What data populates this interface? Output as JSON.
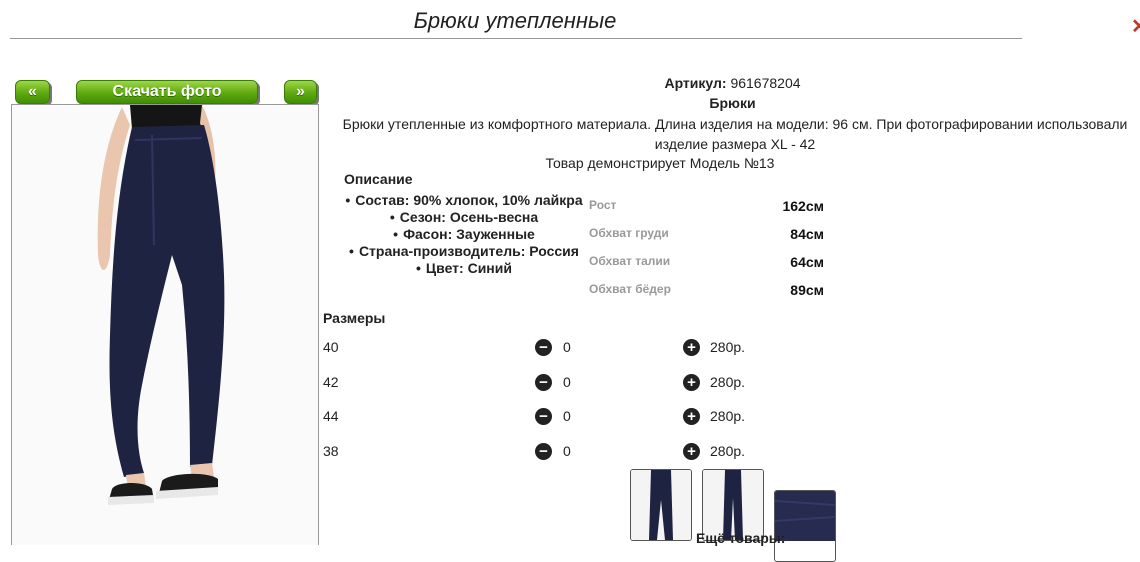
{
  "page": {
    "title": "Брюки утепленные"
  },
  "gallery": {
    "prev_label": "«",
    "download_label": "Скачать фото",
    "next_label": "»"
  },
  "product": {
    "article_label": "Артикул:",
    "article_value": "961678204",
    "name": "Брюки",
    "description": "Брюки утепленные из комфортного материала. Длина изделия на модели: 96 см. При фотографировании использовали изделие размера XL - 42",
    "model_note": "Товар демонстрирует Модель №13"
  },
  "features": {
    "heading": "Описание",
    "items": [
      "Состав: 90% хлопок, 10% лайкра",
      "Сезон: Осень-весна",
      "Фасон: Зауженные",
      "Страна-производитель: Россия",
      "Цвет: Синий"
    ]
  },
  "measurements": [
    {
      "label": "Рост",
      "value": "162см"
    },
    {
      "label": "Обхват груди",
      "value": "84см"
    },
    {
      "label": "Обхват талии",
      "value": "64см"
    },
    {
      "label": "Обхват бёдер",
      "value": "89см"
    }
  ],
  "sizes": {
    "heading": "Размеры",
    "rows": [
      {
        "size": "40",
        "qty": "0",
        "price": "280р."
      },
      {
        "size": "42",
        "qty": "0",
        "price": "280р."
      },
      {
        "size": "44",
        "qty": "0",
        "price": "280р."
      },
      {
        "size": "38",
        "qty": "0",
        "price": "280р."
      }
    ]
  },
  "more_products_label": "Ещё товары:",
  "colors": {
    "accent_green": "#5fa80e",
    "pants": "#1f2342"
  }
}
